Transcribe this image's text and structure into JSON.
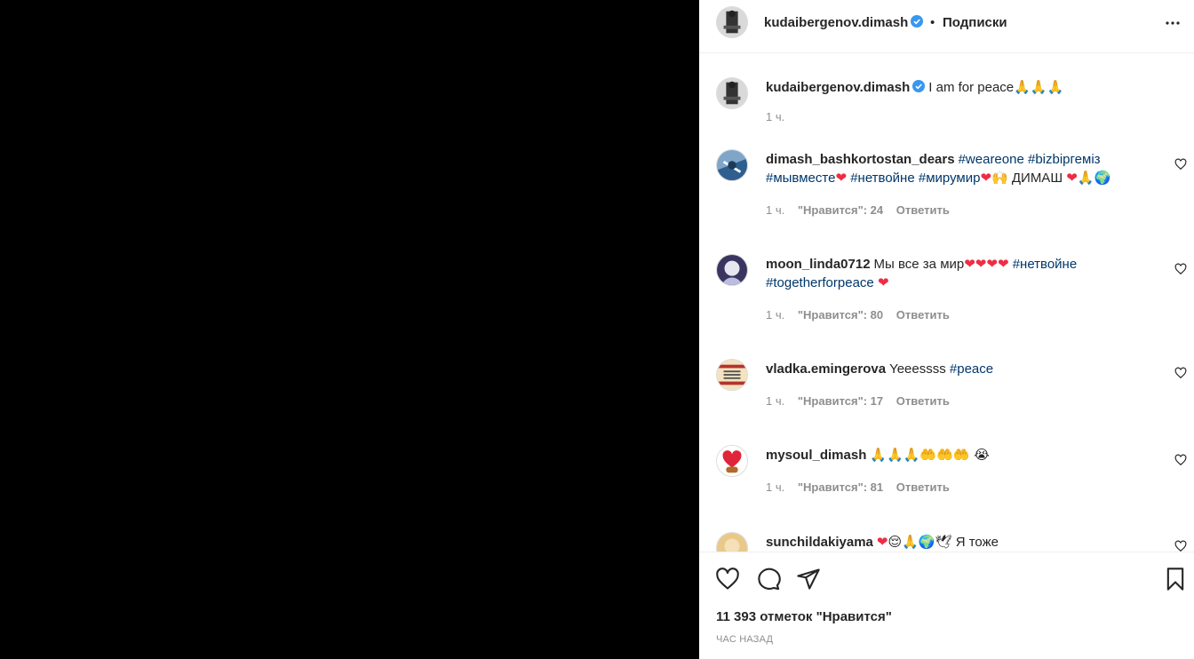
{
  "post": {
    "username": "kudaibergenov.dimash",
    "follow_separator": "•",
    "follow_label": "Подписки",
    "caption": "I am for peace",
    "caption_emoji": "🙏🙏🙏",
    "caption_time": "1 ч."
  },
  "comments": [
    {
      "user": "dimash_bashkortostan_dears",
      "time": "1 ч.",
      "likes": "\"Нравится\": 24",
      "reply": "Ответить"
    },
    {
      "user": "moon_linda0712",
      "time": "1 ч.",
      "likes": "\"Нравится\": 80",
      "reply": "Ответить"
    },
    {
      "user": "vladka.emingerova",
      "time": "1 ч.",
      "likes": "\"Нравится\": 17",
      "reply": "Ответить"
    },
    {
      "user": "mysoul_dimash",
      "time": "1 ч.",
      "likes": "\"Нравится\": 81",
      "reply": "Ответить"
    },
    {
      "user": "sunchildakiyama"
    }
  ],
  "c1": {
    "t1": "#weareone",
    "t2": "#bizbiргеміз",
    "t3": "#мывместе",
    "t4": "#нетвойне",
    "t5": "#мирумир",
    "plain": "ДИМАШ"
  },
  "c2": {
    "plain": "Мы все за мир",
    "t1": "#нетвойне",
    "t2": "#togetherforpeace"
  },
  "c3": {
    "plain": "Yeeessss",
    "t1": "#peace"
  },
  "c4": {
    "emoji": "🙏🙏🙏🤲🤲🤲 😭"
  },
  "c5": {
    "plain": "Я тоже"
  },
  "footer": {
    "likes_text": "11 393 отметок \"Нравится\"",
    "time_ago": "ЧАС НАЗАД"
  },
  "icons": {
    "more": "more-horizontal-icon",
    "like": "heart-outline-icon",
    "comment": "comment-bubble-icon",
    "share": "send-paper-plane-icon",
    "save": "bookmark-icon",
    "verified": "verified-badge-icon"
  },
  "colors": {
    "hashtag": "#00376b",
    "verified": "#3897f0",
    "secondary_text": "#8e8e8e",
    "heart": "#ed2d45"
  }
}
